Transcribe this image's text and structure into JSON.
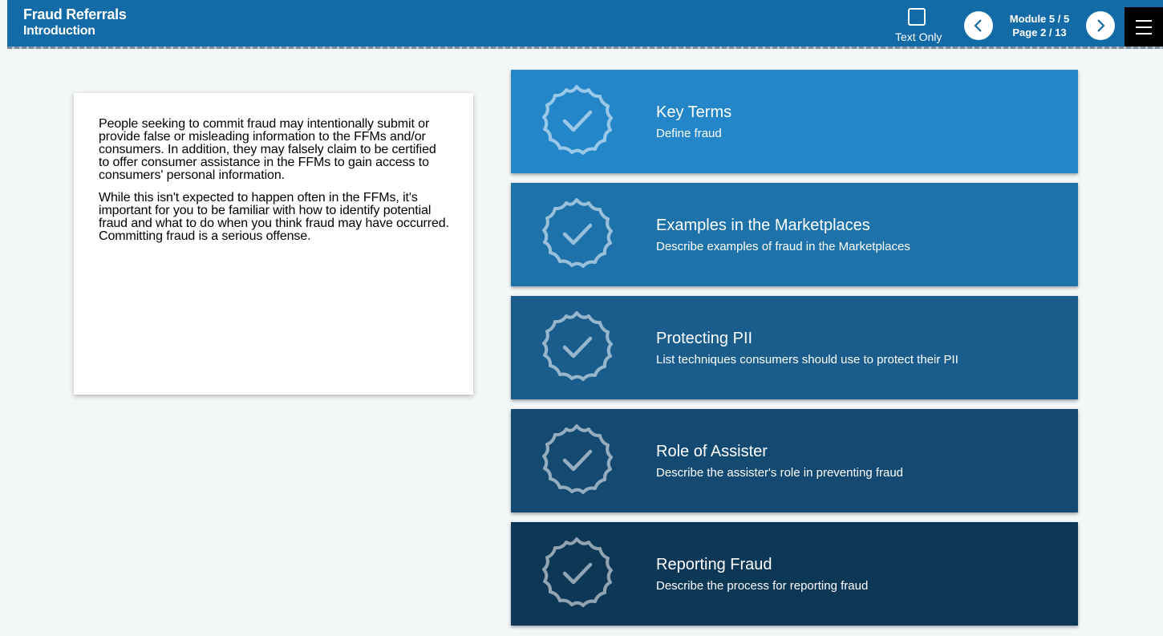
{
  "header": {
    "course_title": "Fraud Referrals",
    "lesson_title": "Introduction",
    "text_only_label": "Text Only",
    "module_progress": "Module 5 / 5",
    "page_progress": "Page 2 / 13"
  },
  "intro": {
    "paragraphs": [
      "People seeking to commit fraud may intentionally submit or provide false or misleading information to the FFMs and/or consumers. In addition, they may falsely claim to be certified to offer consumer assistance in the FFMs to gain access to consumers' personal information.",
      "While this isn't expected to happen often in the FFMs, it's important for you to be familiar with how to identify potential fraud and what to do when you think fraud may have occurred. Committing fraud is a serious offense."
    ]
  },
  "topics": [
    {
      "title": "Key Terms",
      "subtitle": "Define fraud",
      "color": "#2386c8"
    },
    {
      "title": "Examples in the Marketplaces",
      "subtitle": "Describe examples of fraud in the Marketplaces",
      "color": "#1e72aa"
    },
    {
      "title": "Protecting PII",
      "subtitle": "List techniques consumers should use to protect their PII",
      "color": "#1a5d8c"
    },
    {
      "title": "Role of Assister",
      "subtitle": "Describe the assister's role in preventing fraud",
      "color": "#144a72"
    },
    {
      "title": "Reporting Fraud",
      "subtitle": "Describe the process for reporting fraud",
      "color": "#0d3757"
    }
  ],
  "icons": {
    "topic_badge": "badge-check-icon",
    "prev": "chevron-left-icon",
    "next": "chevron-right-icon",
    "menu": "hamburger-menu-icon"
  }
}
